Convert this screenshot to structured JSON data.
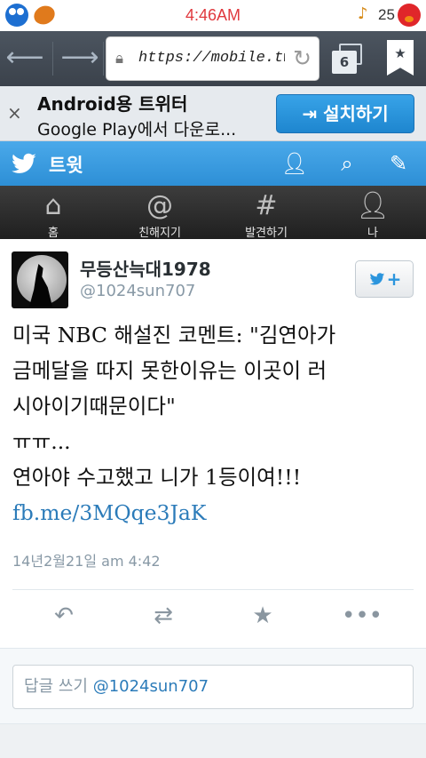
{
  "status_bar": {
    "time_hour": "4:46",
    "time_suffix": "AM",
    "battery": "25",
    "icons": [
      "cookie-monster-icon",
      "ball-icon",
      "music-note-icon",
      "elmo-icon"
    ]
  },
  "browser": {
    "url": "https://mobile.twitter.com",
    "tab_count": "6",
    "icons": [
      "back-arrow-icon",
      "forward-arrow-icon",
      "lock-icon",
      "reload-icon",
      "tabs-icon",
      "bookmark-icon"
    ]
  },
  "banner": {
    "title": "Android용 트위터",
    "subtitle": "Google Play에서 다운로...",
    "install_label": "설치하기",
    "close_glyph": "×"
  },
  "header": {
    "title": "트윗",
    "icons": [
      "twitter-bird-icon",
      "add-user-icon",
      "search-icon",
      "compose-icon"
    ]
  },
  "tabs": [
    {
      "label": "홈",
      "icon": "home-icon"
    },
    {
      "label": "친해지기",
      "icon": "at-icon"
    },
    {
      "label": "발견하기",
      "icon": "hashtag-icon"
    },
    {
      "label": "나",
      "icon": "person-icon"
    }
  ],
  "tweet": {
    "user_name": "무등산늑대1978",
    "handle": "@1024sun707",
    "lines": [
      "미국 NBC 해설진 코멘트: \"김연아가",
      "금메달을 따지 못한이유는 이곳이 러",
      "시아이기때문이다\"",
      "ㅠㅠ...",
      "연아야 수고했고 니가 1등이여!!!"
    ],
    "link": "fb.me/3MQqe3JaK",
    "timestamp": "14년2월21일 am 4:42",
    "actions": [
      "reply-icon",
      "retweet-icon",
      "favorite-icon",
      "more-icon"
    ]
  },
  "reply": {
    "prefix": "답글 쓰기",
    "mention": "@1024sun707"
  },
  "colors": {
    "twitter_blue": "#2d8fd6",
    "link_blue": "#2b7bb9",
    "time_red": "#e0393e",
    "toolbar_dark": "#3b424b"
  }
}
